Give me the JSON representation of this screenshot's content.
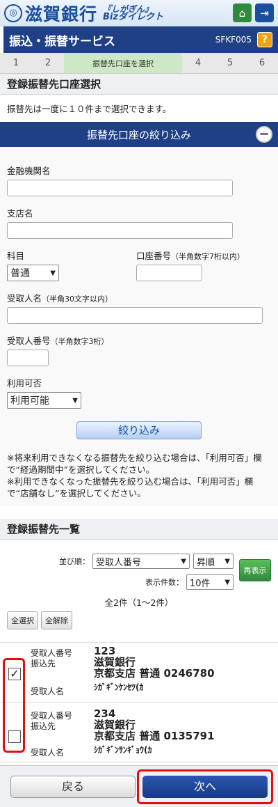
{
  "header": {
    "bank_name": "滋賀銀行",
    "brand_line1": "『しがぎん』",
    "brand_line2": "Bizダイレクト",
    "home_icon": "home-icon",
    "logout_icon": "logout-icon"
  },
  "titlebar": {
    "title": "振込・振替サービス",
    "code": "SFKF005",
    "help_label": "?"
  },
  "steps": [
    {
      "label": "1"
    },
    {
      "label": "2"
    },
    {
      "label": "振替先口座を選択",
      "active": true
    },
    {
      "label": "4"
    },
    {
      "label": "5"
    },
    {
      "label": "6"
    }
  ],
  "section_title": "登録振替先口座選択",
  "note": "振替先は一度に１０件まで選択できます。",
  "filter": {
    "title": "振替先口座の絞り込み",
    "toggle_label": "−",
    "bank_label": "金融機関名",
    "branch_label": "支店名",
    "subject_label": "科目",
    "subject_value": "普通",
    "account_label": "口座番号",
    "account_hint": "（半角数字7桁以内）",
    "recipient_label": "受取人名",
    "recipient_hint": "（半角30文字以内）",
    "recipient_no_label": "受取人番号",
    "recipient_no_hint": "（半角数字3桁）",
    "availability_label": "利用可否",
    "availability_value": "利用可能",
    "button_label": "絞り込み",
    "warning1": "※将来利用できなくなる振替先を絞り込む場合は、「利用可否」欄で“経過期間中”を選択してください。",
    "warning2": "※利用できなくなった振替先を絞り込む場合は、「利用可否」欄で“店舗なし”を選択してください。"
  },
  "list": {
    "title": "登録振替先一覧",
    "sort_label": "並び順：",
    "sort_value": "受取人番号",
    "order_value": "昇順",
    "display_label": "表示件数：",
    "display_value": "10件",
    "refresh_label": "再表示",
    "count_text": "全2件（1～2件）",
    "select_all_label": "全選択",
    "deselect_all_label": "全解除",
    "field_number": "受取人番号",
    "field_dest": "振込先",
    "field_name": "受取人名",
    "items": [
      {
        "number": "123",
        "bank": "滋賀銀行",
        "branch_account": "京都支店 普通 0246780",
        "name": "ｼｶﾞｷﾞﾝｹﾝｾﾂ(ｶ",
        "checked": true,
        "check_mark": "✓"
      },
      {
        "number": "234",
        "bank": "滋賀銀行",
        "branch_account": "京都支店 普通 0135791",
        "name": "ｼｶﾞｷﾞﾝｻﾝｷﾞｮｳ(ｶ",
        "checked": false,
        "check_mark": ""
      }
    ]
  },
  "footer": {
    "back_label": "戻る",
    "next_label": "次へ"
  },
  "colors": {
    "primary": "#1f3f86",
    "accent_green": "#2f8a3c",
    "highlight_red": "#e01010",
    "help_orange": "#f2a20a"
  }
}
